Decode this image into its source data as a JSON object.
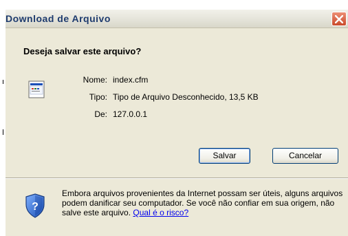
{
  "window": {
    "title": "Download de Arquivo"
  },
  "dialog": {
    "question": "Deseja salvar este arquivo?",
    "fields": [
      {
        "label": "Nome:",
        "value": "index.cfm"
      },
      {
        "label": "Tipo:",
        "value": "Tipo de Arquivo Desconhecido, 13,5 KB"
      },
      {
        "label": "De:",
        "value": "127.0.0.1"
      }
    ],
    "save_label": "Salvar",
    "cancel_label": "Cancelar",
    "warning_text": "Embora arquivos provenientes da Internet possam ser úteis, alguns arquivos podem danificar seu computador. Se você não confiar em sua origem, não salve este arquivo.",
    "risk_link": "Qual é o risco?"
  },
  "icons": {
    "file": "file-icon",
    "security": "security-shield-icon",
    "close": "close-icon"
  },
  "colors": {
    "dialog_bg": "#ece9d8",
    "title_text": "#1e3b6e",
    "close_button": "#c94a2b",
    "link": "#0000ee"
  }
}
